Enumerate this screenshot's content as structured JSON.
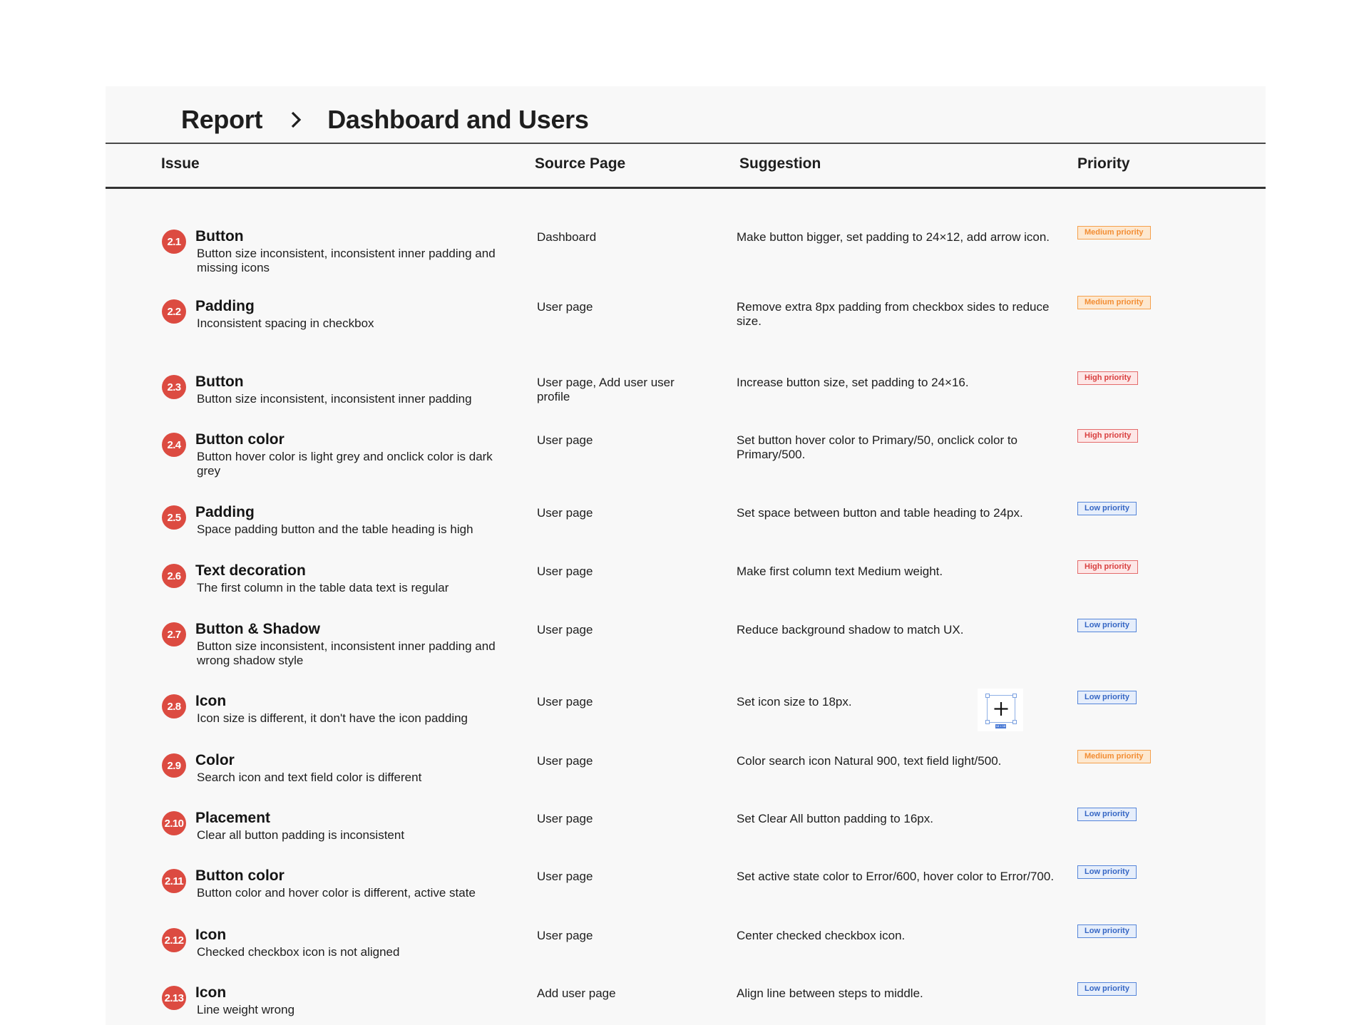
{
  "breadcrumb": {
    "root": "Report",
    "separator_icon": "chevron-right-icon",
    "current": "Dashboard and Users"
  },
  "table": {
    "headers": {
      "issue": "Issue",
      "source": "Source Page",
      "suggestion": "Suggestion",
      "priority": "Priority"
    },
    "priority_styles": {
      "medium": {
        "label": "Medium priority",
        "text": "#f28d33",
        "border": "#f5a04c",
        "background": "#fde8d0"
      },
      "high": {
        "label": "High priority",
        "text": "#d94040",
        "border": "#e46b6b",
        "background": "#fde7e7"
      },
      "low": {
        "label": "Low priority",
        "text": "#3566c4",
        "border": "#5585d9",
        "background": "#e6eefb"
      }
    },
    "rows": [
      {
        "num": "2.1",
        "title": "Button",
        "description": "Button size inconsistent, inconsistent inner padding and missing icons",
        "source": "Dashboard",
        "suggestion": "Make button bigger, set padding to 24×12, add arrow icon.",
        "priority": "Medium priority",
        "level": "medium"
      },
      {
        "num": "2.2",
        "title": "Padding",
        "description": "Inconsistent spacing in checkbox",
        "source": "User page",
        "suggestion": "Remove extra 8px padding from checkbox sides to reduce size.",
        "priority": "Medium priority",
        "level": "medium"
      },
      {
        "num": "2.3",
        "title": "Button",
        "description": "Button size inconsistent, inconsistent inner padding",
        "source": "User page, Add user user profile",
        "suggestion": "Increase button size, set padding to 24×16.",
        "priority": "High priority",
        "level": "high"
      },
      {
        "num": "2.4",
        "title": "Button color",
        "description": "Button hover color is light grey and onclick color is dark grey",
        "source": "User page",
        "suggestion": "Set button hover color to Primary/50, onclick color to Primary/500.",
        "priority": "High priority",
        "level": "high"
      },
      {
        "num": "2.5",
        "title": "Padding",
        "description": "Space padding button and the table heading is high",
        "source": "User page",
        "suggestion": "Set space between button and table heading to 24px.",
        "priority": "Low priority",
        "level": "low"
      },
      {
        "num": "2.6",
        "title": "Text decoration",
        "description": "The first column in the table data text is regular",
        "source": "User page",
        "suggestion": "Make first column text Medium weight.",
        "priority": "High priority",
        "level": "high"
      },
      {
        "num": "2.7",
        "title": "Button & Shadow",
        "description": "Button size inconsistent, inconsistent inner padding and wrong shadow style",
        "source": "User page",
        "suggestion": "Reduce background shadow to match UX.",
        "priority": "Low priority",
        "level": "low"
      },
      {
        "num": "2.8",
        "title": "Icon",
        "description": "Icon size is different, it don't have the icon padding",
        "source": "User page",
        "suggestion": "Set icon size to 18px.",
        "priority": "Low priority",
        "level": "low"
      },
      {
        "num": "2.9",
        "title": "Color",
        "description": "Search icon and text field color is different",
        "source": "User page",
        "suggestion": "Color search icon Natural 900, text field light/500.",
        "priority": "Medium priority",
        "level": "medium"
      },
      {
        "num": "2.10",
        "title": "Placement",
        "description": "Clear all button padding is inconsistent",
        "source": "User page",
        "suggestion": "Set Clear All button padding to 16px.",
        "priority": "Low priority",
        "level": "low"
      },
      {
        "num": "2.11",
        "title": "Button color",
        "description": "Button color and hover color is different, active state",
        "source": "User page",
        "suggestion": "Set active state color to Error/600, hover color to Error/700.",
        "priority": "Low priority",
        "level": "low"
      },
      {
        "num": "2.12",
        "title": "Icon",
        "description": "Checked checkbox icon is not aligned",
        "source": "User page",
        "suggestion": "Center checked checkbox icon.",
        "priority": "Low priority",
        "level": "low"
      },
      {
        "num": "2.13",
        "title": "Icon",
        "description": "Line weight wrong",
        "source": "Add user page",
        "suggestion": "Align line between steps to middle.",
        "priority": "Low priority",
        "level": "low"
      }
    ]
  },
  "icon_sample": {
    "icon": "plus-icon",
    "size_label": "18 × 18"
  },
  "colors": {
    "issue_number_badge": "#dc4b41",
    "panel_background": "#f8f8f8",
    "text": "#1e1e1e"
  }
}
